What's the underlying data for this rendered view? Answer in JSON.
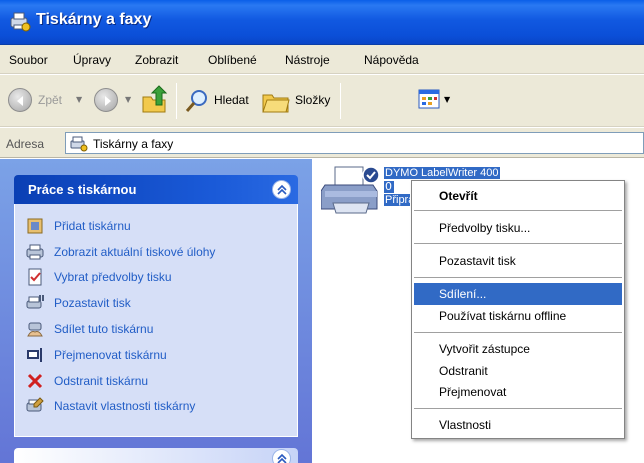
{
  "window": {
    "title": "Tiskárny a faxy"
  },
  "menubar": {
    "items": [
      "Soubor",
      "Úpravy",
      "Zobrazit",
      "Oblíbené",
      "Nástroje",
      "Nápověda"
    ]
  },
  "toolbar": {
    "back_label": "Zpět",
    "search_label": "Hledat",
    "folders_label": "Složky"
  },
  "address": {
    "label": "Adresa",
    "value": "Tiskárny a faxy"
  },
  "taskpane": {
    "panel_title": "Práce s tiskárnou",
    "tasks": [
      {
        "label": "Přidat tiskárnu",
        "icon": "add-printer-icon"
      },
      {
        "label": "Zobrazit aktuální tiskové úlohy",
        "icon": "print-queue-icon"
      },
      {
        "label": "Vybrat předvolby tisku",
        "icon": "print-preferences-icon"
      },
      {
        "label": "Pozastavit tisk",
        "icon": "pause-printing-icon"
      },
      {
        "label": "Sdílet tuto tiskárnu",
        "icon": "share-printer-icon"
      },
      {
        "label": "Přejmenovat tiskárnu",
        "icon": "rename-printer-icon"
      },
      {
        "label": "Odstranit tiskárnu",
        "icon": "delete-printer-icon"
      },
      {
        "label": "Nastavit vlastnosti tiskárny",
        "icon": "printer-properties-icon"
      }
    ]
  },
  "printer": {
    "name": "DYMO LabelWriter 400",
    "documents": "0",
    "status": "Připraveno"
  },
  "context_menu": {
    "groups": [
      [
        "Otevřít"
      ],
      [
        "Předvolby tisku..."
      ],
      [
        "Pozastavit tisk"
      ],
      [
        "Sdílení...",
        "Používat tiskárnu offline"
      ],
      [
        "Vytvořit zástupce",
        "Odstranit",
        "Přejmenovat"
      ],
      [
        "Vlastnosti"
      ]
    ],
    "default_item": "Otevřít",
    "highlighted_item": "Sdílení..."
  },
  "colors": {
    "title_bar": "#0a5ee8",
    "task_link": "#215dc6",
    "selection": "#316ac5",
    "pane_background": "#7ba2e7"
  }
}
